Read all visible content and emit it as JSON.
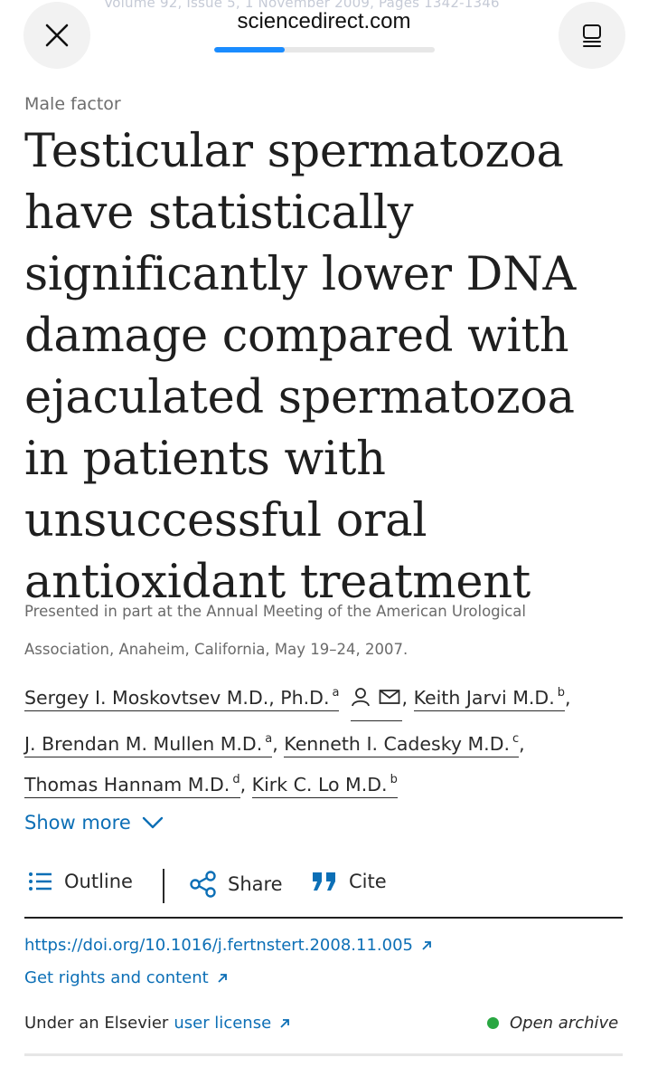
{
  "browser": {
    "domain": "sciencedirect.com",
    "background_text": "Volume 92, Issue 5, 1 November 2009, Pages 1342-1346",
    "progress": 0.32,
    "accent_color": "#1a8cff"
  },
  "article": {
    "section": "Male factor",
    "title": "Testicular spermatozoa have statistically significantly lower DNA damage compared with ejaculated spermatozoa in patients with unsuccessful oral antioxidant treatment",
    "note": "Presented in part at the Annual Meeting of the American Urological Association, Anaheim, California, May 19–24, 2007.",
    "authors": [
      {
        "name": "Sergey I. Moskovtsev M.D., Ph.D.",
        "sup": "a"
      },
      {
        "name": "Keith Jarvi M.D.",
        "sup": "b"
      },
      {
        "name": "J. Brendan M. Mullen M.D.",
        "sup": "a"
      },
      {
        "name": "Kenneth I. Cadesky M.D.",
        "sup": "c"
      },
      {
        "name": "Thomas Hannam M.D.",
        "sup": "d"
      },
      {
        "name": "Kirk C. Lo M.D.",
        "sup": "b"
      }
    ],
    "author_separator": ",",
    "show_more": "Show more",
    "actions": {
      "outline": "Outline",
      "share": "Share",
      "cite": "Cite"
    },
    "doi": "https://doi.org/10.1016/j.fertnstert.2008.11.005",
    "rights": "Get rights and content",
    "license_prefix": "Under an Elsevier",
    "license_link": "user license",
    "access": "Open archive"
  },
  "colors": {
    "link": "#0c6fb6",
    "open_dot": "#29a742"
  },
  "icons": {
    "close": "close-icon",
    "reader": "reader-mode-icon",
    "person": "person-icon",
    "mail": "mail-icon",
    "chevron": "chevron-down-icon",
    "outline": "list-icon",
    "share": "share-icon",
    "cite": "quote-icon",
    "external": "external-link-icon"
  }
}
